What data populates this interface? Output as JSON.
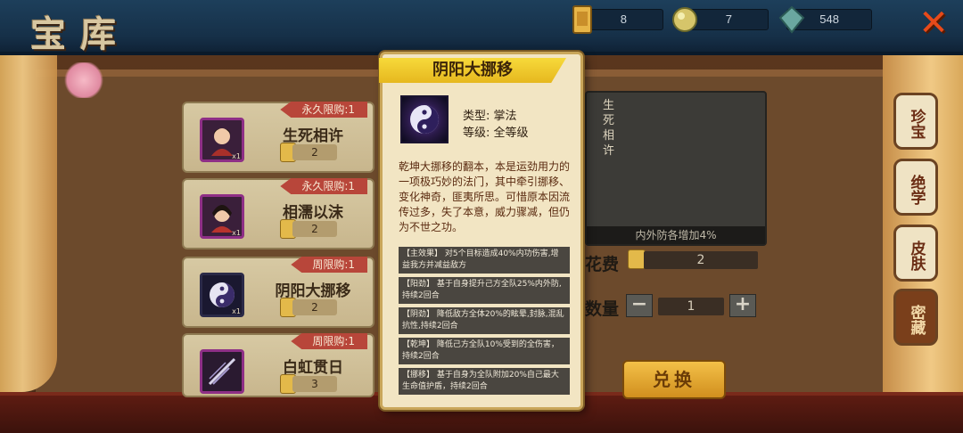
{
  "header": {
    "title": "宝库",
    "resources": [
      {
        "icon": "scroll-ticket-icon",
        "value": "8"
      },
      {
        "icon": "gold-orb-icon",
        "value": "7"
      },
      {
        "icon": "jade-gem-icon",
        "value": "548"
      }
    ],
    "close_label": "✕"
  },
  "items": [
    {
      "badge": "永久限购:1",
      "name": "生死相许",
      "cost": "2",
      "icon": "character-portrait-icon",
      "qty_tag": "x1"
    },
    {
      "badge": "永久限购:1",
      "name": "相濡以沫",
      "cost": "2",
      "icon": "character-portrait-icon",
      "qty_tag": "x1"
    },
    {
      "badge": "周限购:1",
      "name": "阴阳大挪移",
      "cost": "2",
      "icon": "yin-yang-skill-icon",
      "qty_tag": "x1"
    },
    {
      "badge": "周限购:1",
      "name": "白虹贯日",
      "cost": "3",
      "icon": "sword-skill-icon",
      "qty_tag": ""
    }
  ],
  "detail": {
    "vertical_title": "生死相许",
    "footer_text": "内外防各增加4%",
    "cost_label": "花费",
    "cost_value": "2",
    "qty_label": "数量",
    "qty_value": "1",
    "minus_label": "−",
    "plus_label": "+",
    "exchange_label": "兑换"
  },
  "side_tabs": [
    "珍宝",
    "绝学",
    "皮肤",
    "密藏"
  ],
  "popup": {
    "title": "阴阳大挪移",
    "type_line": "类型: 掌法",
    "level_line": "等级: 全等级",
    "description": "乾坤大挪移的翻本，本是运劲用力的一项极巧妙的法门，其中牵引挪移、变化神奇，匪夷所思。可惜原本因流传过多，失了本意，威力骤减，但仍为不世之功。",
    "effects": [
      "【主效果】 对5个目标造成40%内功伤害,增益我方并减益敌方",
      "【阳劲】 基于自身提升己方全队25%内外防,持续2回合",
      "【阴劲】 降低敌方全体20%的眩晕,封脉,混乱抗性,持续2回合",
      "【乾坤】 降低己方全队10%受到的全伤害，持续2回合",
      "【挪移】 基于自身为全队附加20%自己最大生命值护盾，持续2回合"
    ]
  },
  "colors": {
    "accent_gold": "#f7d93a",
    "badge_red": "#b8463a",
    "close_orange": "#e84a1a"
  }
}
